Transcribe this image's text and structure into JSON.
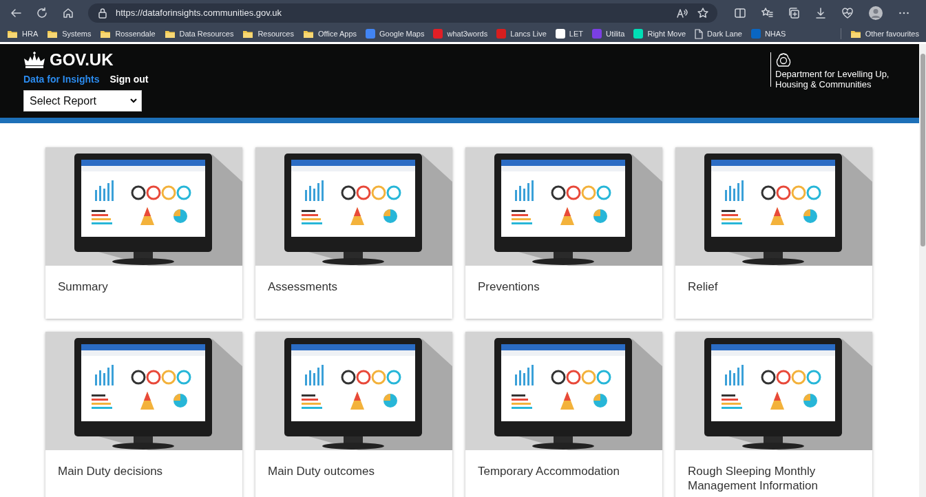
{
  "browser": {
    "address_bar": {
      "value": "https://dataforinsights.communities.gov.uk"
    },
    "bookmarks": [
      {
        "label": "HRA",
        "kind": "folder"
      },
      {
        "label": "Systems",
        "kind": "folder"
      },
      {
        "label": "Rossendale",
        "kind": "folder"
      },
      {
        "label": "Data Resources",
        "kind": "folder"
      },
      {
        "label": "Resources",
        "kind": "folder"
      },
      {
        "label": "Office Apps",
        "kind": "folder"
      },
      {
        "label": "Google Maps",
        "kind": "site",
        "color": "#4285f4"
      },
      {
        "label": "what3words",
        "kind": "site",
        "color": "#e11f26"
      },
      {
        "label": "Lancs Live",
        "kind": "site",
        "color": "#d81e1e"
      },
      {
        "label": "LET",
        "kind": "site",
        "color": "#ffffff"
      },
      {
        "label": "Utilita",
        "kind": "site",
        "color": "#7b3fe4"
      },
      {
        "label": "Right Move",
        "kind": "site",
        "color": "#00deb6"
      },
      {
        "label": "Dark Lane",
        "kind": "page"
      },
      {
        "label": "NHAS",
        "kind": "site",
        "color": "#0a66c2"
      }
    ],
    "other_bookmarks": {
      "label": "Other favourites"
    }
  },
  "header": {
    "logo": "GOV.UK",
    "service_name": "Data for Insights",
    "sign_out": "Sign out",
    "report_select": {
      "value": "Select Report"
    },
    "department": "Department for Levelling Up, Housing & Communities"
  },
  "cards": [
    {
      "title": "Summary"
    },
    {
      "title": "Assessments"
    },
    {
      "title": "Preventions"
    },
    {
      "title": "Relief"
    },
    {
      "title": "Main Duty decisions"
    },
    {
      "title": "Main Duty outcomes"
    },
    {
      "title": "Temporary Accommodation"
    },
    {
      "title": "Rough Sleeping Monthly Management Information"
    }
  ]
}
